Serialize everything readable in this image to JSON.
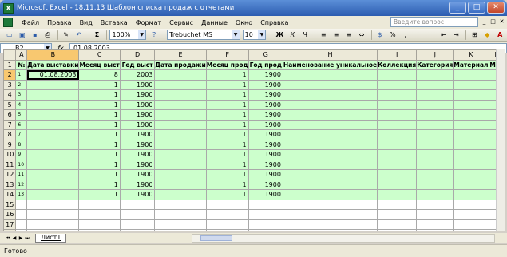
{
  "window": {
    "title": "Microsoft Excel - 18.11.13 Шаблон списка продаж с отчетами",
    "app_icon_letter": "X",
    "buttons": {
      "minimize": "_",
      "maximize": "□",
      "close": "✕"
    }
  },
  "menu": {
    "items": [
      "Файл",
      "Правка",
      "Вид",
      "Вставка",
      "Формат",
      "Сервис",
      "Данные",
      "Окно",
      "Справка"
    ],
    "help_placeholder": "Введите вопрос",
    "doc_buttons": [
      "_",
      "□",
      "✕"
    ]
  },
  "toolbar": {
    "zoom": "100%",
    "font": "Trebuchet MS",
    "font_size": "10",
    "bold_label": "Ж",
    "italic_label": "К",
    "underline_label": "Ч",
    "sum_label": "Σ"
  },
  "formula_bar": {
    "name_box": "B2",
    "fx_label": "fx",
    "content": "01.08.2003"
  },
  "sheet": {
    "columns": [
      "A",
      "B",
      "C",
      "D",
      "E",
      "F",
      "G",
      "H",
      "I",
      "J",
      "K",
      "L"
    ],
    "headers": [
      "№",
      "Дата выставки",
      "Месяц выст",
      "Год выст",
      "Дата продажи",
      "Месяц прод",
      "Год прод",
      "Наименование уникальное",
      "Коллекция",
      "Категория",
      "Материал",
      "Мат"
    ],
    "rows": [
      {
        "n": "1",
        "b": "01.08.2003",
        "c": "8",
        "d": "2003",
        "f": "1",
        "g": "1900"
      },
      {
        "n": "2",
        "b": "",
        "c": "1",
        "d": "1900",
        "f": "1",
        "g": "1900"
      },
      {
        "n": "3",
        "b": "",
        "c": "1",
        "d": "1900",
        "f": "1",
        "g": "1900"
      },
      {
        "n": "4",
        "b": "",
        "c": "1",
        "d": "1900",
        "f": "1",
        "g": "1900"
      },
      {
        "n": "5",
        "b": "",
        "c": "1",
        "d": "1900",
        "f": "1",
        "g": "1900"
      },
      {
        "n": "6",
        "b": "",
        "c": "1",
        "d": "1900",
        "f": "1",
        "g": "1900"
      },
      {
        "n": "7",
        "b": "",
        "c": "1",
        "d": "1900",
        "f": "1",
        "g": "1900"
      },
      {
        "n": "8",
        "b": "",
        "c": "1",
        "d": "1900",
        "f": "1",
        "g": "1900"
      },
      {
        "n": "9",
        "b": "",
        "c": "1",
        "d": "1900",
        "f": "1",
        "g": "1900"
      },
      {
        "n": "10",
        "b": "",
        "c": "1",
        "d": "1900",
        "f": "1",
        "g": "1900"
      },
      {
        "n": "11",
        "b": "",
        "c": "1",
        "d": "1900",
        "f": "1",
        "g": "1900"
      },
      {
        "n": "12",
        "b": "",
        "c": "1",
        "d": "1900",
        "f": "1",
        "g": "1900"
      },
      {
        "n": "13",
        "b": "",
        "c": "1",
        "d": "1900",
        "f": "1",
        "g": "1900"
      }
    ],
    "row_numbers": [
      "1",
      "2",
      "3",
      "4",
      "5",
      "6",
      "7",
      "8",
      "9",
      "10",
      "11",
      "12",
      "13",
      "14",
      "15",
      "16",
      "17",
      "18"
    ],
    "active_row": "2",
    "active_col": "B"
  },
  "tabs": {
    "nav": [
      "⏮",
      "◀",
      "▶",
      "⏭"
    ],
    "sheet_tab": "Лист1"
  },
  "status": {
    "text": "Готово"
  }
}
